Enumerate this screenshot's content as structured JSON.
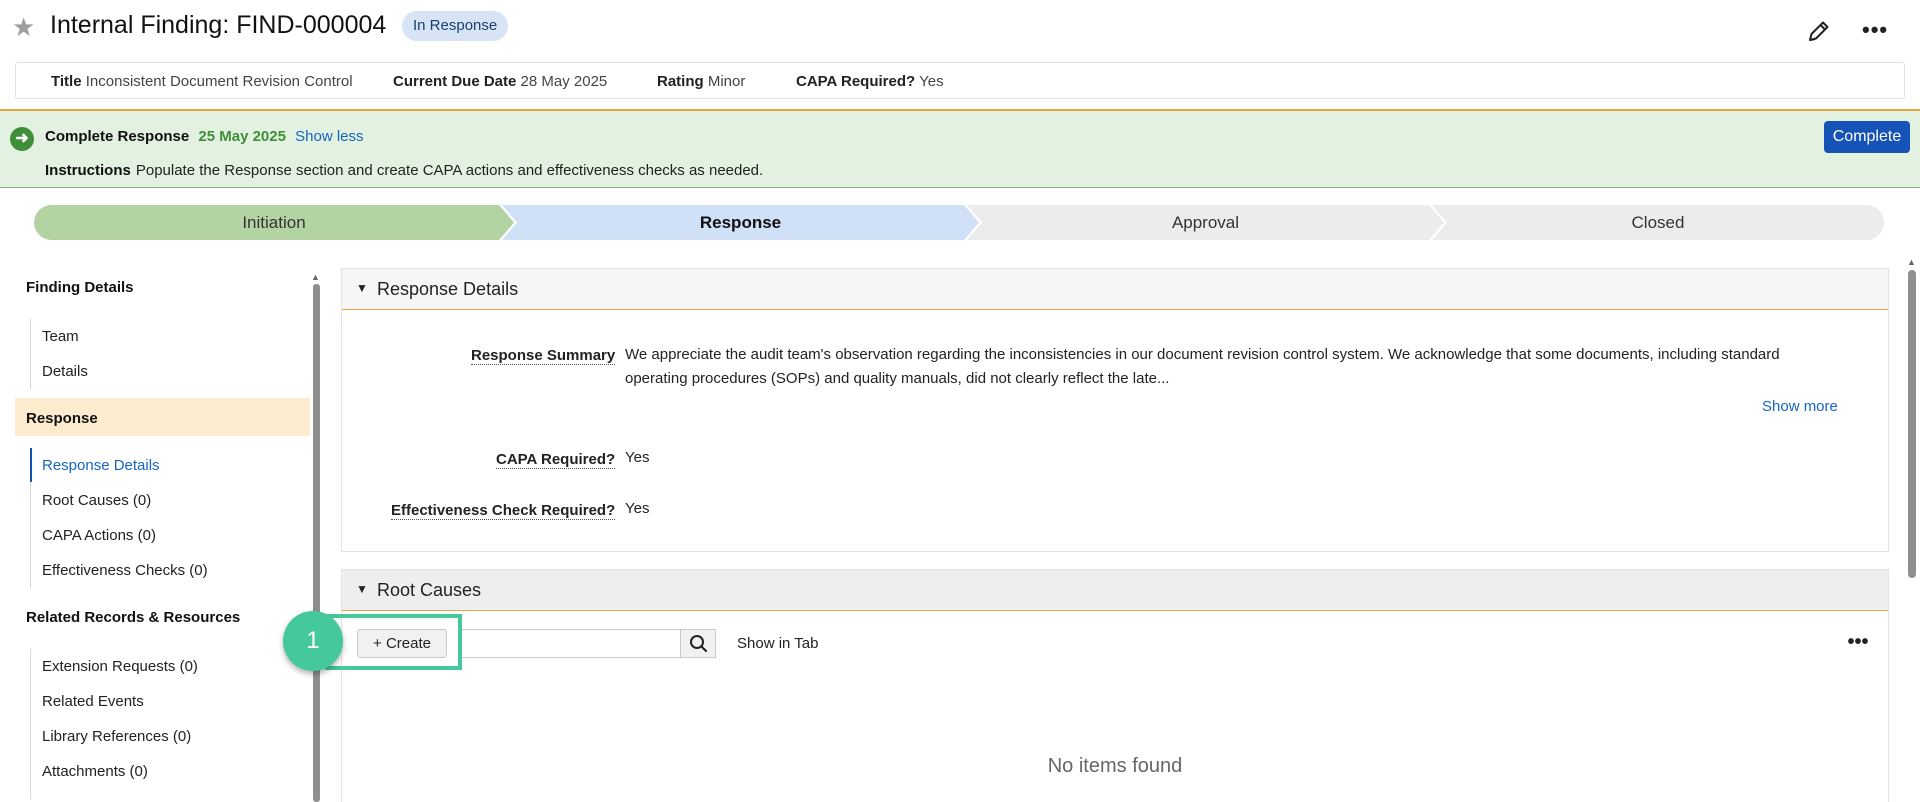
{
  "header": {
    "title": "Internal Finding: FIND-000004",
    "status": "In Response"
  },
  "info": {
    "title_label": "Title",
    "title_value": "Inconsistent Document Revision Control",
    "due_label": "Current Due Date",
    "due_value": "28 May 2025",
    "rating_label": "Rating",
    "rating_value": "Minor",
    "capa_label": "CAPA Required?",
    "capa_value": "Yes"
  },
  "banner": {
    "action": "Complete Response",
    "date": "25 May 2025",
    "toggle_link": "Show less",
    "instructions_label": "Instructions",
    "instructions_text": "Populate the Response section and create CAPA actions and effectiveness checks as needed.",
    "complete_button": "Complete"
  },
  "stages": [
    {
      "label": "Initiation",
      "state": "done"
    },
    {
      "label": "Response",
      "state": "current"
    },
    {
      "label": "Approval",
      "state": "pending"
    },
    {
      "label": "Closed",
      "state": "pending"
    }
  ],
  "nav": {
    "section_finding": "Finding Details",
    "item_team": "Team",
    "item_details": "Details",
    "section_response": "Response",
    "item_response_details": "Response Details",
    "item_root_causes": "Root Causes (0)",
    "item_capa_actions": "CAPA Actions (0)",
    "item_effectiveness": "Effectiveness Checks (0)",
    "section_related": "Related Records & Resources",
    "item_extension": "Extension Requests (0)",
    "item_related_events": "Related Events",
    "item_library": "Library References (0)",
    "item_attachments": "Attachments (0)"
  },
  "response_details": {
    "section_title": "Response Details",
    "summary_label": "Response Summary",
    "summary_value": "We appreciate the audit team's observation regarding the inconsistencies in our document revision control system. We acknowledge that some documents, including standard operating procedures (SOPs) and quality manuals, did not clearly reflect the late...",
    "show_more": "Show more",
    "capa_label": "CAPA Required?",
    "capa_value": "Yes",
    "effectiveness_label": "Effectiveness Check Required?",
    "effectiveness_value": "Yes"
  },
  "root_causes": {
    "section_title": "Root Causes",
    "create_button": "+ Create",
    "search_placeholder": "",
    "show_in_tab": "Show in Tab",
    "empty_text": "No items found"
  },
  "annotation": {
    "step_number": "1",
    "color": "#45c89a"
  },
  "colors": {
    "primary": "#1553b6",
    "banner_bg": "#e2f1e0",
    "stage_done": "#b3d4a2",
    "stage_current": "#cfe0f7",
    "stage_pending": "#ececec"
  }
}
